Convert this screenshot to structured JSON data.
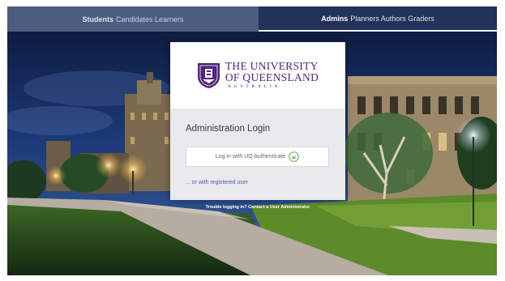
{
  "tabs": {
    "students": {
      "strong": "Students",
      "sub": "Candidates Learners"
    },
    "admins": {
      "strong": "Admins",
      "sub": "Planners Authors Graders"
    }
  },
  "logo": {
    "line1": "THE UNIVERSITY",
    "line2": "OF QUEENSLAND",
    "line3": "AUSTRALIA",
    "crest_icon": "uq-crest-icon"
  },
  "login": {
    "title": "Administration Login",
    "auth_button_label": "Log in with UQ Authenticate",
    "auth_button_icon": "fingerprint-icon",
    "alt_link": "... or with registered user"
  },
  "footer": {
    "trouble": "Trouble logging in? Contact a User Administrator"
  },
  "colors": {
    "uq_purple": "#51247a",
    "admin_tab": "#22325a",
    "student_tab": "#4c5d80",
    "icon_green": "#5cae4e"
  }
}
